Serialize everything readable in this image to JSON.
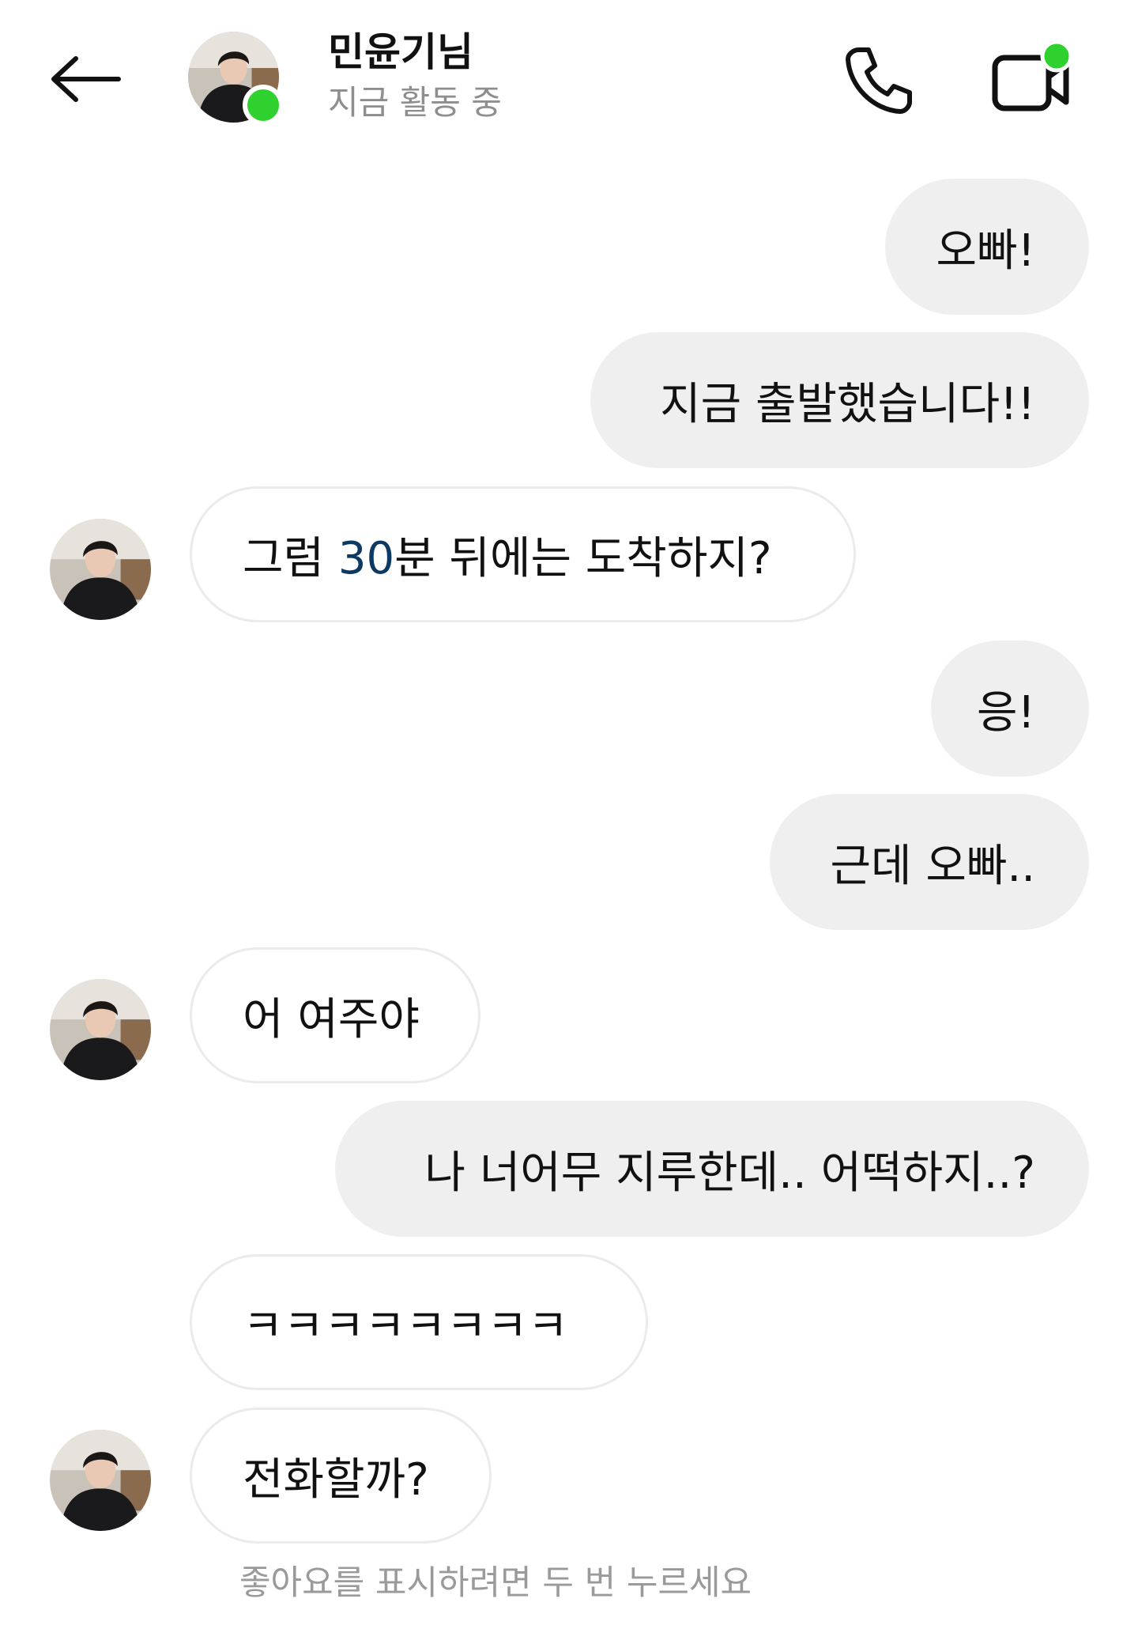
{
  "colors": {
    "online": "#2fd12f",
    "sent_bubble": "#efefef",
    "received_border": "#ebebeb",
    "highlight_number": "#0d3a63",
    "secondary_text": "#8e8e8e"
  },
  "header": {
    "back_icon": "arrow-left-icon",
    "contact_name": "민윤기님",
    "status": "지금 활동 중",
    "call_icon": "phone-icon",
    "video_icon": "video-camera-icon"
  },
  "messages": [
    {
      "direction": "sent",
      "text": "오빠!"
    },
    {
      "direction": "sent",
      "text": "지금 출발했습니다!!"
    },
    {
      "direction": "received",
      "text_before": "그럼 ",
      "text_number": "30",
      "text_after": "분 뒤에는 도착하지?"
    },
    {
      "direction": "sent",
      "text": "응!"
    },
    {
      "direction": "sent",
      "text": "근데 오빠.."
    },
    {
      "direction": "received",
      "text": "어 여주야"
    },
    {
      "direction": "sent",
      "text": "나 너어무 지루한데.. 어떡하지..?"
    },
    {
      "direction": "received",
      "text": "ㅋㅋㅋㅋㅋㅋㅋㅋ"
    },
    {
      "direction": "received",
      "text": "전화할까?"
    }
  ],
  "footer": {
    "hint": "좋아요를 표시하려면 두 번 누르세요"
  }
}
